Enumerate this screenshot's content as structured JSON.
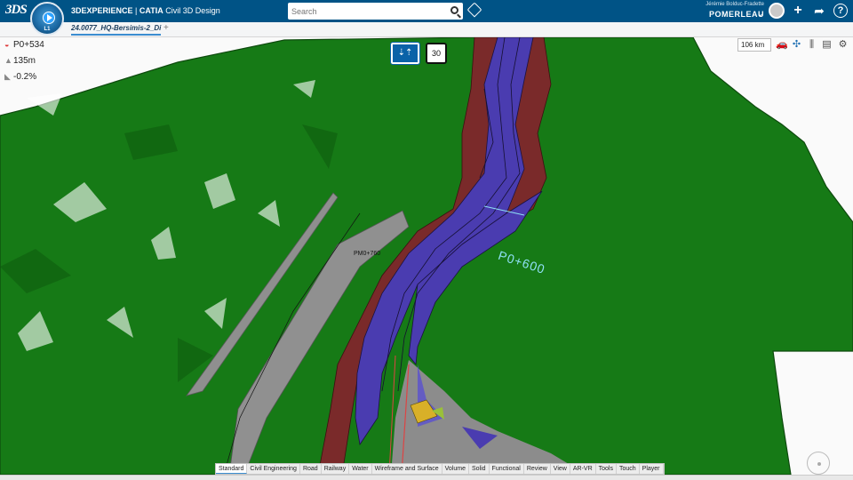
{
  "header": {
    "logo": "3DS",
    "compass_level": "L1",
    "brand_prefix": "3DEXPERIENCE",
    "brand_separator": " | ",
    "brand_app": "CATIA",
    "brand_role": "Civil 3D Design",
    "search_placeholder": "Search",
    "user_name": "Jérémie Bolduc-Fradette",
    "tenant": "POMERLEAU",
    "colors": {
      "bar": "#005386",
      "accent": "#3c8dd0"
    },
    "icons": [
      "search-icon",
      "tag-icon",
      "avatar",
      "plus-icon",
      "share-icon",
      "help-icon"
    ]
  },
  "tabs": {
    "active": "24.0077_HQ-Bersimis-2_Di",
    "add_symbol": "+"
  },
  "indicators": {
    "station": "P0+534",
    "elevation": "135m",
    "slope": "-0.2%"
  },
  "navigation": {
    "direction_symbol": "⇣⇡",
    "speed": "30",
    "distance": "106 km"
  },
  "scene_labels": {
    "station_marker": "P0+600",
    "profile_marker": "PM0+760"
  },
  "action_bar": {
    "tabs": [
      "Standard",
      "Civil Engineering",
      "Road",
      "Railway",
      "Water",
      "Wireframe and Surface",
      "Volume",
      "Solid",
      "Functional",
      "Review",
      "View",
      "AR-VR",
      "Tools",
      "Touch",
      "Player"
    ],
    "active": "Standard"
  },
  "scene_colors": {
    "terrain": "#167a16",
    "road": "#4a3cb0",
    "embankment": "#7a2a2a",
    "structure": "#8f8f8f"
  }
}
